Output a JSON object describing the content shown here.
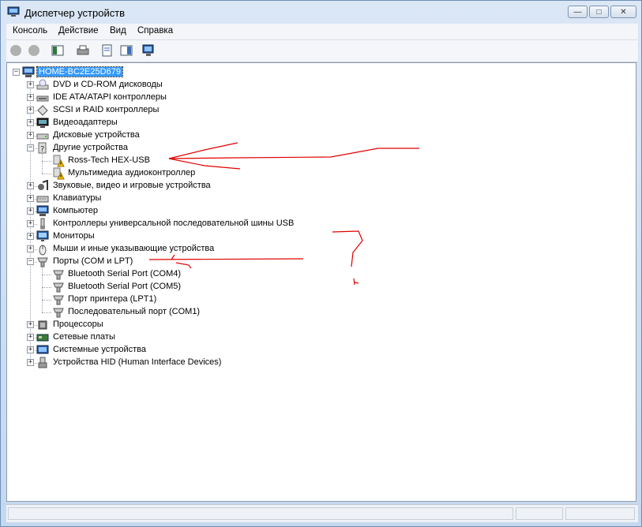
{
  "window": {
    "title": "Диспетчер устройств",
    "controls": {
      "minimize": "—",
      "maximize": "□",
      "close": "✕"
    }
  },
  "menu": [
    "Консоль",
    "Действие",
    "Вид",
    "Справка"
  ],
  "toolbar_icons": [
    "back-icon",
    "forward-icon",
    "show-hide-tree-icon",
    "print-icon",
    "properties-icon",
    "help-icon",
    "update-driver-icon"
  ],
  "tree": {
    "root": "HOME-BC2E25D679",
    "items": [
      {
        "label": "DVD и CD-ROM дисководы",
        "icon": "dvd-drive-icon",
        "expander": "+"
      },
      {
        "label": "IDE ATA/ATAPI контроллеры",
        "icon": "ide-controller-icon",
        "expander": "+"
      },
      {
        "label": "SCSI и RAID контроллеры",
        "icon": "scsi-controller-icon",
        "expander": "+"
      },
      {
        "label": "Видеоадаптеры",
        "icon": "display-adapter-icon",
        "expander": "+"
      },
      {
        "label": "Дисковые устройства",
        "icon": "disk-drive-icon",
        "expander": "+"
      },
      {
        "label": "Другие устройства",
        "icon": "unknown-device-icon",
        "expander": "−",
        "children": [
          {
            "label": "Ross-Tech HEX-USB",
            "icon": "warning-device-icon"
          },
          {
            "label": "Мультимедиа аудиоконтроллер",
            "icon": "warning-device-icon"
          }
        ]
      },
      {
        "label": "Звуковые, видео и игровые устройства",
        "icon": "sound-device-icon",
        "expander": "+"
      },
      {
        "label": "Клавиатуры",
        "icon": "keyboard-icon",
        "expander": "+"
      },
      {
        "label": "Компьютер",
        "icon": "computer-icon",
        "expander": "+"
      },
      {
        "label": "Контроллеры универсальной последовательной шины USB",
        "icon": "usb-controller-icon",
        "expander": "+"
      },
      {
        "label": "Мониторы",
        "icon": "monitor-icon",
        "expander": "+"
      },
      {
        "label": "Мыши и иные указывающие устройства",
        "icon": "mouse-icon",
        "expander": "+"
      },
      {
        "label": "Порты (COM и LPT)",
        "icon": "port-icon",
        "expander": "−",
        "children": [
          {
            "label": "Bluetooth Serial Port (COM4)",
            "icon": "port-icon"
          },
          {
            "label": "Bluetooth Serial Port (COM5)",
            "icon": "port-icon"
          },
          {
            "label": "Порт принтера (LPT1)",
            "icon": "port-icon"
          },
          {
            "label": "Последовательный порт (COM1)",
            "icon": "port-icon"
          }
        ]
      },
      {
        "label": "Процессоры",
        "icon": "processor-icon",
        "expander": "+"
      },
      {
        "label": "Сетевые платы",
        "icon": "network-adapter-icon",
        "expander": "+"
      },
      {
        "label": "Системные устройства",
        "icon": "system-device-icon",
        "expander": "+"
      },
      {
        "label": "Устройства HID (Human Interface Devices)",
        "icon": "hid-device-icon",
        "expander": "+"
      }
    ]
  },
  "colors": {
    "selection": "#3399ff",
    "annotation": "#e00000",
    "warning": "#f5c400"
  }
}
